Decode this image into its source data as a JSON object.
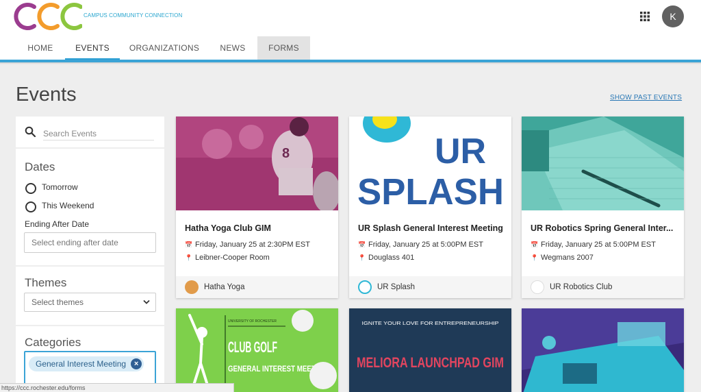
{
  "header": {
    "logo_letters": "CCC",
    "logo_text": "CAMPUS COMMUNITY CONNECTION",
    "avatar_initial": "K"
  },
  "nav": {
    "items": [
      {
        "label": "HOME"
      },
      {
        "label": "EVENTS"
      },
      {
        "label": "ORGANIZATIONS"
      },
      {
        "label": "NEWS"
      },
      {
        "label": "FORMS"
      }
    ],
    "active": "EVENTS"
  },
  "page": {
    "title": "Events",
    "show_past_label": "SHOW PAST EVENTS"
  },
  "sidebar": {
    "search_placeholder": "Search Events",
    "dates_heading": "Dates",
    "date_options": [
      {
        "label": "Tomorrow"
      },
      {
        "label": "This Weekend"
      }
    ],
    "ending_after_label": "Ending After Date",
    "ending_after_placeholder": "Select ending after date",
    "themes_heading": "Themes",
    "themes_placeholder": "Select themes",
    "categories_heading": "Categories",
    "selected_category": "General Interest Meeting"
  },
  "cards": [
    {
      "title": "Hatha Yoga Club GIM",
      "date": "Friday, January 25 at 2:30PM EST",
      "location": "Leibner-Cooper Room",
      "org": "Hatha Yoga"
    },
    {
      "title": "UR Splash General Interest Meeting",
      "date": "Friday, January 25 at 5:00PM EST",
      "location": "Douglass 401",
      "org": "UR Splash",
      "image_text_top": "UR",
      "image_text_bottom": "SPLASH"
    },
    {
      "title": "UR Robotics Spring General Inter...",
      "date": "Friday, January 25 at 5:00PM EST",
      "location": "Wegmans 2007",
      "org": "UR Robotics Club"
    }
  ],
  "cards_row2": [
    {
      "image_small": "UNIVERSITY OF ROCHESTER",
      "image_title": "CLUB GOLF",
      "image_subtitle": "GENERAL INTEREST MEETING"
    },
    {
      "image_small": "IGNITE YOUR LOVE FOR ENTREPRENEURSHIP",
      "image_title": "MELIORA LAUNCHPAD GIM"
    },
    {}
  ],
  "statusbar": {
    "url": "https://ccc.rochester.edu/forms"
  },
  "colors": {
    "accent": "#3aa3d6",
    "logo_purple": "#9b3c8f",
    "logo_orange": "#f39c2c",
    "logo_green": "#8cc63f",
    "link": "#2a78b5"
  },
  "icons": [
    "apps-grid-icon",
    "search-icon",
    "calendar-icon",
    "location-pin-icon",
    "chevron-down-icon",
    "close-icon"
  ]
}
